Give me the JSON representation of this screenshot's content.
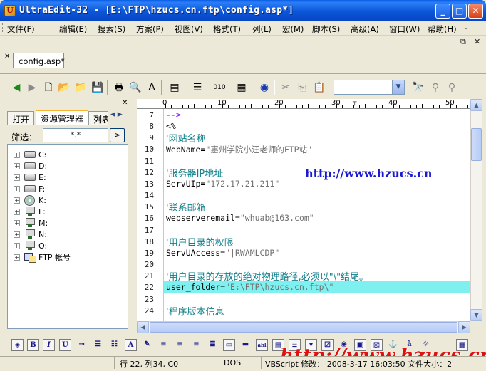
{
  "window": {
    "title": "UltraEdit-32 - [E:\\FTP\\hzucs.cn.ftp\\config.asp*]",
    "app_icon": "U"
  },
  "menu": [
    "文件(F)",
    "编辑(E)",
    "搜索(S)",
    "方案(P)",
    "视图(V)",
    "格式(T)",
    "列(L)",
    "宏(M)",
    "脚本(S)",
    "高级(A)",
    "窗口(W)",
    "帮助(H)"
  ],
  "document_tab": {
    "label": "config.asp*"
  },
  "left_panel": {
    "tabs": [
      "打开",
      "资源管理器",
      "列表"
    ],
    "filter_label": "筛选：",
    "filter_value": "*.*",
    "filter_button": ">",
    "tree": [
      {
        "label": "C:",
        "icon": "drive-icon"
      },
      {
        "label": "D:",
        "icon": "drive-icon"
      },
      {
        "label": "E:",
        "icon": "drive-icon"
      },
      {
        "label": "F:",
        "icon": "drive-icon"
      },
      {
        "label": "K:",
        "icon": "cd-icon"
      },
      {
        "label": "L:",
        "icon": "network-drive-icon"
      },
      {
        "label": "M:",
        "icon": "network-drive-icon"
      },
      {
        "label": "N:",
        "icon": "network-drive-icon"
      },
      {
        "label": "O:",
        "icon": "network-drive-icon"
      },
      {
        "label": "FTP 帐号",
        "icon": "ftp-account-icon"
      }
    ]
  },
  "ruler": {
    "labels": [
      "0",
      "10",
      "20",
      "30",
      "40",
      "50"
    ]
  },
  "editor": {
    "lines": [
      {
        "n": "7",
        "text": "-->",
        "style": "kw"
      },
      {
        "n": "8",
        "text": "<%",
        "style": "normal"
      },
      {
        "n": "9",
        "text": "'网站名称",
        "style": "comment"
      },
      {
        "n": "10",
        "pre": "WebName=",
        "str": "\"惠州学院小汪老师的FTP站\"",
        "style": "assign"
      },
      {
        "n": "11",
        "text": "",
        "style": "normal"
      },
      {
        "n": "12",
        "text": "'服务器IP地址",
        "style": "comment"
      },
      {
        "n": "13",
        "pre": "ServUIp=",
        "str": "\"172.17.21.211\"",
        "style": "assign"
      },
      {
        "n": "14",
        "text": "",
        "style": "normal"
      },
      {
        "n": "15",
        "text": "'联系邮箱",
        "style": "comment"
      },
      {
        "n": "16",
        "pre": "webserveremail=",
        "str": "\"whuab@163.com\"",
        "style": "assign"
      },
      {
        "n": "17",
        "text": "",
        "style": "normal"
      },
      {
        "n": "18",
        "text": "'用户目录的权限",
        "style": "comment"
      },
      {
        "n": "19",
        "pre": "ServUAccess=",
        "str": "\"|RWAMLCDP\"",
        "style": "assign"
      },
      {
        "n": "20",
        "text": "",
        "style": "normal"
      },
      {
        "n": "21",
        "text": "'用户目录的存放的绝对物理路径,必须以\"\\\"结尾。",
        "style": "comment"
      },
      {
        "n": "22",
        "pre": "user_folder=",
        "str": "\"E:\\FTP\\hzucs.cn.ftp\\\"",
        "style": "assign"
      },
      {
        "n": "23",
        "text": "",
        "style": "normal"
      },
      {
        "n": "24",
        "text": "'程序版本信息",
        "style": "comment"
      }
    ]
  },
  "watermarks": {
    "blue": "http://www.hzucs.cn",
    "red": "http://www.hzucs.cn"
  },
  "status": {
    "position": "行 22, 列34, C0",
    "line_ending": "DOS",
    "rest": "VBScript  修改： 2008-3-17 16:03:50  文件大小：2"
  },
  "colors": {
    "title_bar": "#0a55d8",
    "comment": "#0f7f8a",
    "highlight_line": "#7ff0f0",
    "watermark_red": "#e01010",
    "watermark_blue": "#1a1ad0"
  }
}
